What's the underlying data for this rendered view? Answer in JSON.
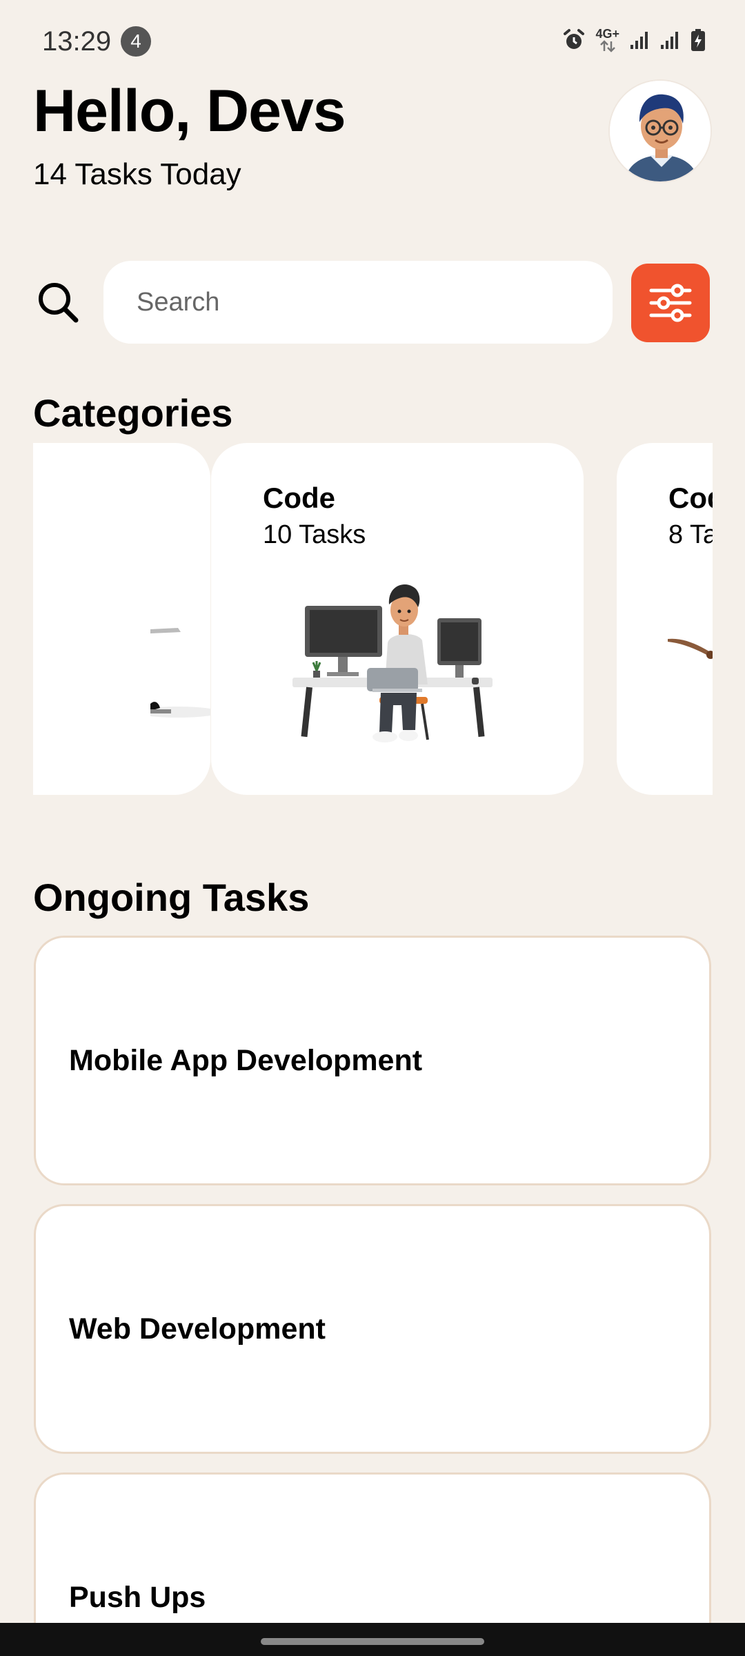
{
  "status_bar": {
    "time": "13:29",
    "notification_count": "4",
    "network": "4G+"
  },
  "header": {
    "greeting": "Hello, Devs",
    "subtitle": "14 Tasks Today"
  },
  "search": {
    "placeholder": "Search",
    "value": ""
  },
  "categories": {
    "title": "Categories",
    "items": [
      {
        "name": "",
        "count": ""
      },
      {
        "name": "Code",
        "count": "10 Tasks"
      },
      {
        "name": "Cod",
        "count": "8 Ta"
      }
    ]
  },
  "ongoing": {
    "title": "Ongoing Tasks",
    "tasks": [
      {
        "name": "Mobile App Development"
      },
      {
        "name": "Web Development"
      },
      {
        "name": "Push Ups"
      }
    ]
  },
  "colors": {
    "background": "#f5f0ea",
    "accent": "#f0532e",
    "card": "#ffffff",
    "card_border": "#ead9c8"
  },
  "icons": {
    "search": "search-icon",
    "filter": "sliders-icon",
    "alarm": "alarm-icon",
    "signal": "signal-icon",
    "battery": "battery-charging-icon"
  }
}
